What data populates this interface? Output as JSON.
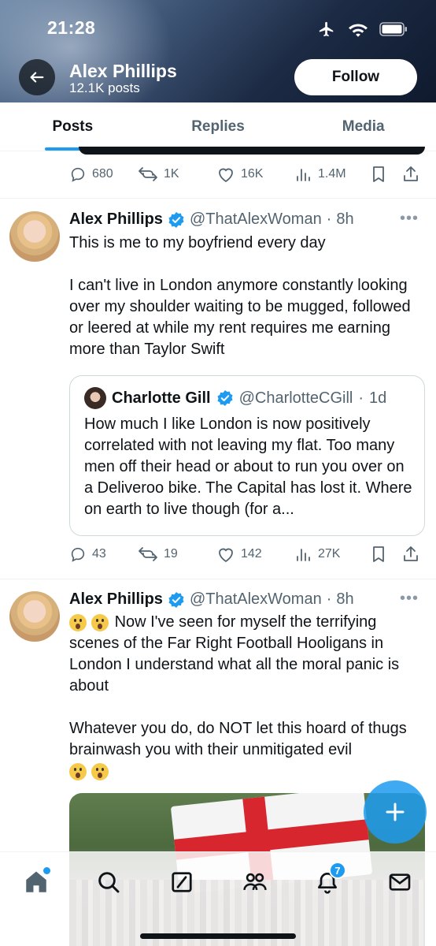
{
  "status_bar": {
    "time": "21:28"
  },
  "profile": {
    "name": "Alex Phillips",
    "posts_count": "12.1K posts",
    "follow_label": "Follow"
  },
  "tabs": [
    {
      "label": "Posts",
      "active": true
    },
    {
      "label": "Replies",
      "active": false
    },
    {
      "label": "Media",
      "active": false
    }
  ],
  "previous_post": {
    "replies": "680",
    "reposts": "1K",
    "likes": "16K",
    "views": "1.4M"
  },
  "tweets": [
    {
      "name": "Alex Phillips",
      "handle": "@ThatAlexWoman",
      "time": "8h",
      "text_1": "This is me to my boyfriend every day",
      "text_2": "I can't live in London anymore constantly looking over my shoulder waiting to be mugged, followed or leered at while my rent requires me earning more than Taylor Swift",
      "quote": {
        "name": "Charlotte Gill",
        "handle": "@CharlotteCGill",
        "time": "1d",
        "text": "How much I like London is now positively correlated with not leaving my flat. Too many men off their head or about to run you over on a Deliveroo bike. The Capital has lost it. Where on earth to live though (for a..."
      },
      "replies": "43",
      "reposts": "19",
      "likes": "142",
      "views": "27K"
    },
    {
      "name": "Alex Phillips",
      "handle": "@ThatAlexWoman",
      "time": "8h",
      "text_1": "Now I've seen for myself the terrifying scenes of the Far Right Football Hooligans in London I understand what all the moral panic is about",
      "text_2": "Whatever you do, do NOT let this hoard of thugs brainwash you with their unmitigated evil"
    }
  ],
  "bottom_nav": {
    "notifications_badge": "7"
  },
  "colors": {
    "accent": "#1d9bf0",
    "text_secondary": "#536471",
    "verified": "#1d9bf0"
  },
  "icons": [
    "back-arrow-icon",
    "airplane-icon",
    "wifi-icon",
    "battery-icon",
    "reply-icon",
    "repost-icon",
    "like-icon",
    "views-icon",
    "bookmark-icon",
    "share-icon",
    "verified-badge-icon",
    "more-icon",
    "compose-plus-icon",
    "home-icon",
    "search-icon",
    "grok-icon",
    "communities-icon",
    "notifications-icon",
    "messages-icon"
  ]
}
